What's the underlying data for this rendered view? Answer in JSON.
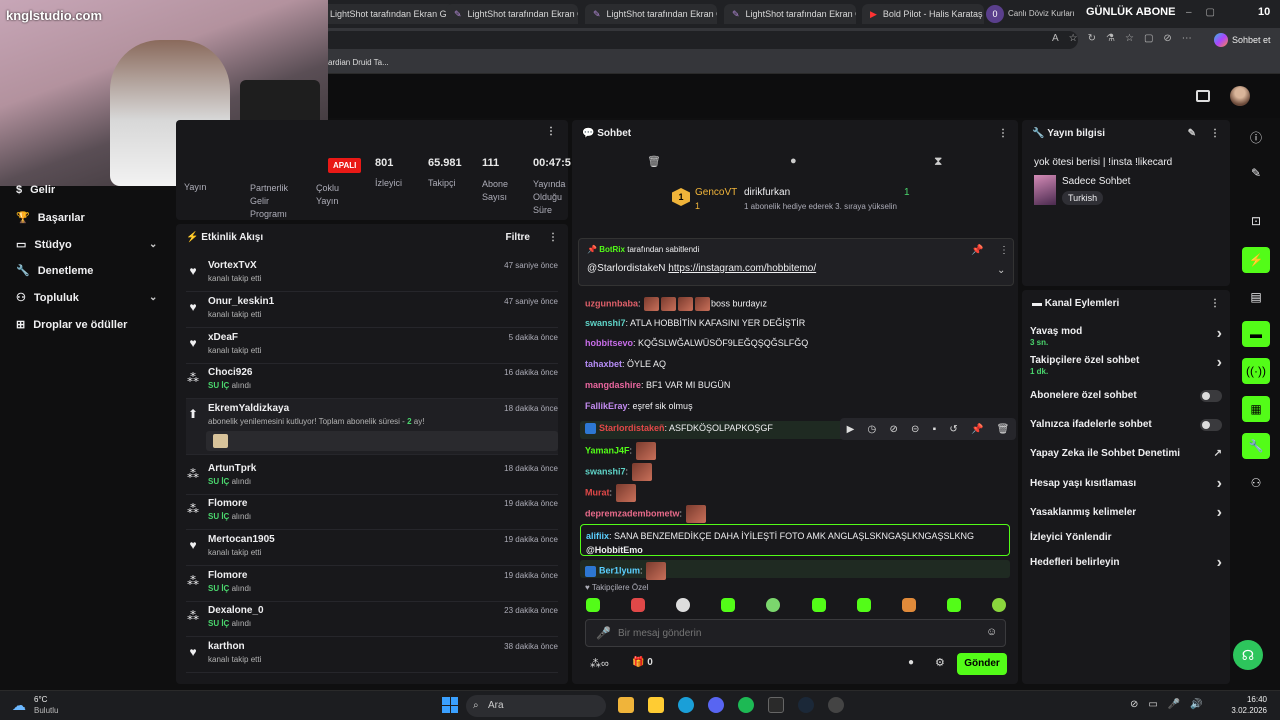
{
  "browser": {
    "tabs": [
      {
        "label": "LightShot tarafından Ekran G"
      },
      {
        "label": "LightShot tarafından Ekran G"
      },
      {
        "label": "LightShot tarafından Ekran G"
      },
      {
        "label": "LightShot tarafından Ekran G"
      },
      {
        "label": "Bold Pilot - Halis Karataş | 1"
      },
      {
        "label": "Canlı Döviz Kurları"
      }
    ],
    "badge_count": "0",
    "overlay_title": "GÜNLÜK ABONE",
    "overlay_count": "10",
    "chat_button": "Sohbet et",
    "bookmark": "ardian Druid Ta..."
  },
  "watermark": "knglstudio.com",
  "stats": {
    "live_badge": "APALI",
    "items": [
      {
        "value": "",
        "label": "Yayın"
      },
      {
        "value": "",
        "label": "Partnerlik Gelir Programı"
      },
      {
        "value": "",
        "label": "Çoklu Yayın"
      },
      {
        "value": "801",
        "label": "İzleyici"
      },
      {
        "value": "65.981",
        "label": "Takipçi"
      },
      {
        "value": "111",
        "label": "Abone Sayısı"
      },
      {
        "value": "00:47:5",
        "label": "Yayında Olduğu Süre"
      }
    ]
  },
  "sidebar": {
    "items": [
      {
        "label": "Gelir"
      },
      {
        "label": "Başarılar"
      },
      {
        "label": "Stüdyo"
      },
      {
        "label": "Denetleme"
      },
      {
        "label": "Topluluk"
      },
      {
        "label": "Droplar ve ödüller"
      }
    ]
  },
  "activity": {
    "title": "Etkinlik Akışı",
    "filter": "Filtre",
    "items": [
      {
        "name": "VortexTvX",
        "sub": "kanalı takip etti",
        "time": "47 saniye önce"
      },
      {
        "name": "Onur_keskin1",
        "sub": "kanalı takip etti",
        "time": "47 saniye önce"
      },
      {
        "name": "xDeaF",
        "sub": "kanalı takip etti",
        "time": "5 dakika önce"
      },
      {
        "name": "Choci926",
        "sub_hl": "SU İÇ",
        "sub": "alındı",
        "time": "16 dakika önce"
      },
      {
        "name": "EkremYaldizkaya",
        "sub": "abonelik yenilemesini kutluyor! Toplam abonelik süresi -",
        "sub_count": "2",
        "sub_tail": "ay!",
        "time": "18 dakika önce"
      },
      {
        "name": "ArtunTprk",
        "sub_hl": "SU İÇ",
        "sub": "alındı",
        "time": "18 dakika önce"
      },
      {
        "name": "Flomore",
        "sub_hl": "SU İÇ",
        "sub": "alındı",
        "time": "19 dakika önce"
      },
      {
        "name": "Mertocan1905",
        "sub": "kanalı takip etti",
        "time": "19 dakika önce"
      },
      {
        "name": "Flomore",
        "sub_hl": "SU İÇ",
        "sub": "alındı",
        "time": "19 dakika önce"
      },
      {
        "name": "Dexalone_0",
        "sub_hl": "SU İÇ",
        "sub": "alındı",
        "time": "23 dakika önce"
      },
      {
        "name": "karthon",
        "sub": "kanalı takip etti",
        "time": "38 dakika önce"
      }
    ]
  },
  "chat": {
    "title": "Sohbet",
    "gift_top": {
      "name": "GencoVT",
      "rank": "1",
      "count": "1"
    },
    "gift_second": {
      "name": "dirikfurkan",
      "count": "1",
      "detail": "1 abonelik hediye ederek 3. sıraya yükselin"
    },
    "pinned": {
      "by": "BotRix",
      "by_suffix": "tarafından sabitlendi",
      "mention": "@StarlordistakeN",
      "link": "https://instagram.com/hobbitemo/"
    },
    "messages": [
      {
        "user": "uzgunnbaba",
        "color": "#e0606a",
        "text": "boss burdayız"
      },
      {
        "user": "swanshi7",
        "color": "#5fd3c7",
        "text": "ATLA HOBBİTİN KAFASINI YER DEĞİŞTİR"
      },
      {
        "user": "hobbitsevo",
        "color": "#c76de8",
        "text": "KQĞSLWĞALWÜSÖF9LEĞQŞQĞSLFĞQ"
      },
      {
        "user": "tahaxbet",
        "color": "#b58cf5",
        "text": "ÖYLE AQ"
      },
      {
        "user": "mangdashire",
        "color": "#e8669e",
        "text": "BF1 VAR MI BUGÜN"
      },
      {
        "user": "FallikEray",
        "color": "#c38bf0",
        "text": "eşref sik olmuş"
      },
      {
        "user": "Starlordistakeñ",
        "color": "#e04848",
        "text": "ASFDKÖŞOLPAPKOŞGF"
      },
      {
        "user": "YamanJ4F",
        "color": "#53fc18",
        "text": ""
      },
      {
        "user": "swanshi7",
        "color": "#5fd3c7",
        "text": ""
      },
      {
        "user": "Murat",
        "color": "#e04848",
        "text": ""
      },
      {
        "user": "depremzadembometw",
        "color": "#e86a8a",
        "text": ""
      },
      {
        "user": "alifiix",
        "color": "#5bd0ff",
        "text": "SANA BENZEMEDİKÇE DAHA İYİLEŞTİ FOTO AMK ANGLAŞLSKNGAŞLKNGAŞSLKNG",
        "mention": "@HobbitEmo"
      },
      {
        "user": "Ber1lyum",
        "color": "#5bd0ff",
        "text": ""
      }
    ],
    "followers_only": "Takipçilere Özel",
    "input_placeholder": "Bir mesaj gönderin",
    "send_button": "Gönder",
    "viewer_count": "0"
  },
  "stream_info": {
    "title": "Yayın bilgisi",
    "stream_title": "yok ötesi berisi | !insta !likecard",
    "category": "Sadece Sohbet",
    "tag": "Turkish"
  },
  "channel_actions": {
    "title": "Kanal Eylemleri",
    "items": [
      {
        "label": "Yavaş mod",
        "sub": "3 sn.",
        "control": "chevron"
      },
      {
        "label": "Takipçilere özel sohbet",
        "sub": "1 dk.",
        "control": "chevron"
      },
      {
        "label": "Abonelere özel sohbet",
        "control": "toggle"
      },
      {
        "label": "Yalnızca ifadelerle sohbet",
        "control": "toggle"
      },
      {
        "label": "Yapay Zeka ile Sohbet Denetimi",
        "control": "external"
      },
      {
        "label": "Hesap yaşı kısıtlaması",
        "control": "chevron"
      },
      {
        "label": "Yasaklanmış kelimeler",
        "control": "chevron"
      },
      {
        "label": "İzleyici Yönlendir",
        "control": "none"
      },
      {
        "label": "Hedefleri belirleyin",
        "control": "chevron"
      }
    ]
  },
  "taskbar": {
    "weather_temp": "6°C",
    "weather_desc": "Bulutlu",
    "search": "Ara",
    "time": "16:40",
    "date": "3.02.2026"
  },
  "colors": {
    "accent": "#53fc18",
    "bg": "#0f0f10",
    "panel": "#18181b"
  }
}
